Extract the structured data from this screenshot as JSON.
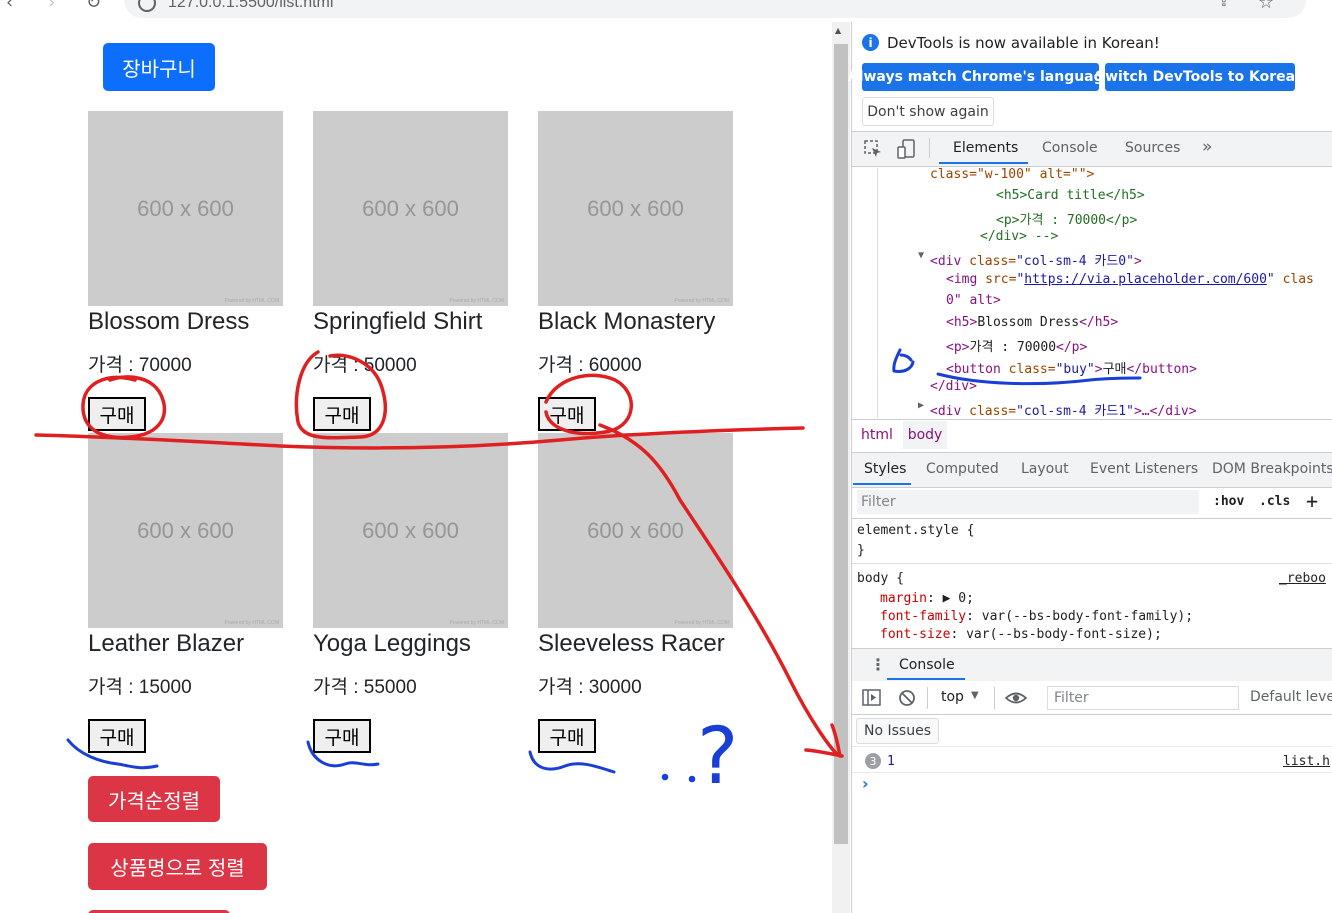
{
  "browser": {
    "url": "127.0.0.1:5500/list.html"
  },
  "page": {
    "cart_button": "장바구니",
    "placeholder_text": "600 x 600",
    "placeholder_credit": "Powered by HTML.COM",
    "buy_label": "구매",
    "products": [
      {
        "title": "Blossom Dress",
        "price": "가격 : 70000"
      },
      {
        "title": "Springfield Shirt",
        "price": "가격 : 50000"
      },
      {
        "title": "Black Monastery",
        "price": "가격 : 60000"
      },
      {
        "title": "Leather Blazer",
        "price": "가격 : 15000"
      },
      {
        "title": "Yoga Leggings",
        "price": "가격 : 55000"
      },
      {
        "title": "Sleeveless Racer",
        "price": "가격 : 30000"
      }
    ],
    "sort_price_button": "가격순정렬",
    "sort_name_button": "상품명으로 정렬"
  },
  "devtools": {
    "info_text": "DevTools is now available in Korean!",
    "match_language_button": "Always match Chrome's language",
    "switch_korean_button": "Switch DevTools to Korean",
    "dont_show_button": "Don't show again",
    "tabs": [
      "Elements",
      "Console",
      "Sources"
    ],
    "more_tabs": "»",
    "elements_code": {
      "line1": "class=\"w-100\" alt=\"\">",
      "line2": "<h5>Card title</h5>",
      "line3": "<p>가격 : 70000</p>",
      "line4": "</div> -->",
      "line5_tag": "<div ",
      "line5_attr": "class=",
      "line5_val": "\"col-sm-4 카드0\"",
      "line5_end": ">",
      "line6_tag": "<img ",
      "line6_attr": "src=",
      "line6_link": "https://via.placeholder.com/600",
      "line6_attr2": "clas",
      "line7": "0\" alt>",
      "line8_open": "<h5>",
      "line8_text": "Blossom Dress",
      "line8_close": "</h5>",
      "line9_open": "<p>",
      "line9_text": "가격 : 70000",
      "line9_close": "</p>",
      "line10_open": "<button ",
      "line10_attr": "class=",
      "line10_val": "\"buy\"",
      "line10_gt": ">",
      "line10_text": "구매",
      "line10_close": "</button>",
      "line11": "</div>",
      "line12_tag": "<div ",
      "line12_attr": "class=",
      "line12_val": "\"col-sm-4 카드1\"",
      "line12_end": ">…</div>"
    },
    "breadcrumbs": [
      "html",
      "body"
    ],
    "styles_tabs": [
      "Styles",
      "Computed",
      "Layout",
      "Event Listeners",
      "DOM Breakpoints"
    ],
    "styles_filter_placeholder": "Filter",
    "hov": ":hov",
    "cls": ".cls",
    "plus": "+",
    "element_style": "element.style {",
    "close_brace": "}",
    "body_selector": "body {",
    "body_source": "_reboo",
    "rules": [
      {
        "prop": "margin",
        "value": "▶ 0;"
      },
      {
        "prop": "font-family",
        "value": "var(--bs-body-font-family);"
      },
      {
        "prop": "font-size",
        "value": "var(--bs-body-font-size);"
      }
    ],
    "console_tab": "Console",
    "console_context": "top",
    "console_filter_placeholder": "Filter",
    "default_levels": "Default leve",
    "no_issues": "No Issues",
    "log_count": "3",
    "log_value": "1",
    "log_source": "list.h",
    "prompt": "›"
  },
  "annotation": {
    "question_mark": "?"
  },
  "colors": {
    "primary": "#0d6efd",
    "danger": "#dc3545",
    "placeholder_bg": "#cccccc",
    "red_ink": "#e02020",
    "blue_ink": "#1a3fd6"
  }
}
